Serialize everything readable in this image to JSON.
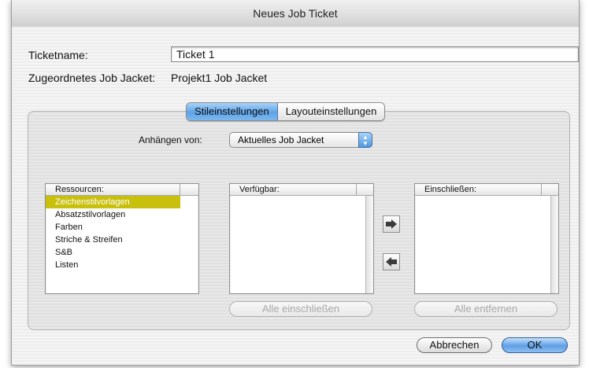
{
  "window": {
    "title": "Neues Job Ticket"
  },
  "form": {
    "ticketname_label": "Ticketname:",
    "ticketname_value": "Ticket 1",
    "job_jacket_label": "Zugeordnetes Job Jacket:",
    "job_jacket_value": "Projekt1 Job Jacket"
  },
  "tabs": [
    {
      "label": "Stileinstellungen",
      "selected": true
    },
    {
      "label": "Layouteinstellungen",
      "selected": false
    }
  ],
  "append": {
    "label": "Anhängen von:",
    "selected": "Aktuelles Job Jacket"
  },
  "resources": {
    "header": "Ressourcen:",
    "items": [
      "Zeichenstilvorlagen",
      "Absatzstilvorlagen",
      "Farben",
      "Striche & Streifen",
      "S&B",
      "Listen"
    ],
    "selected_index": 0,
    "selection_color": "#c9c00e"
  },
  "available": {
    "header": "Verfügbar:",
    "items": []
  },
  "include": {
    "header": "Einschließen:",
    "items": []
  },
  "buttons": {
    "include_all": "Alle einschließen",
    "remove_all": "Alle entfernen",
    "cancel": "Abbrechen",
    "ok": "OK"
  },
  "icons": {
    "move_right": "arrow-right-icon",
    "move_left": "arrow-left-icon",
    "popup": "up-down-arrows-icon"
  },
  "colors": {
    "accent": "#5ea2e6",
    "selection": "#c9c00e"
  }
}
